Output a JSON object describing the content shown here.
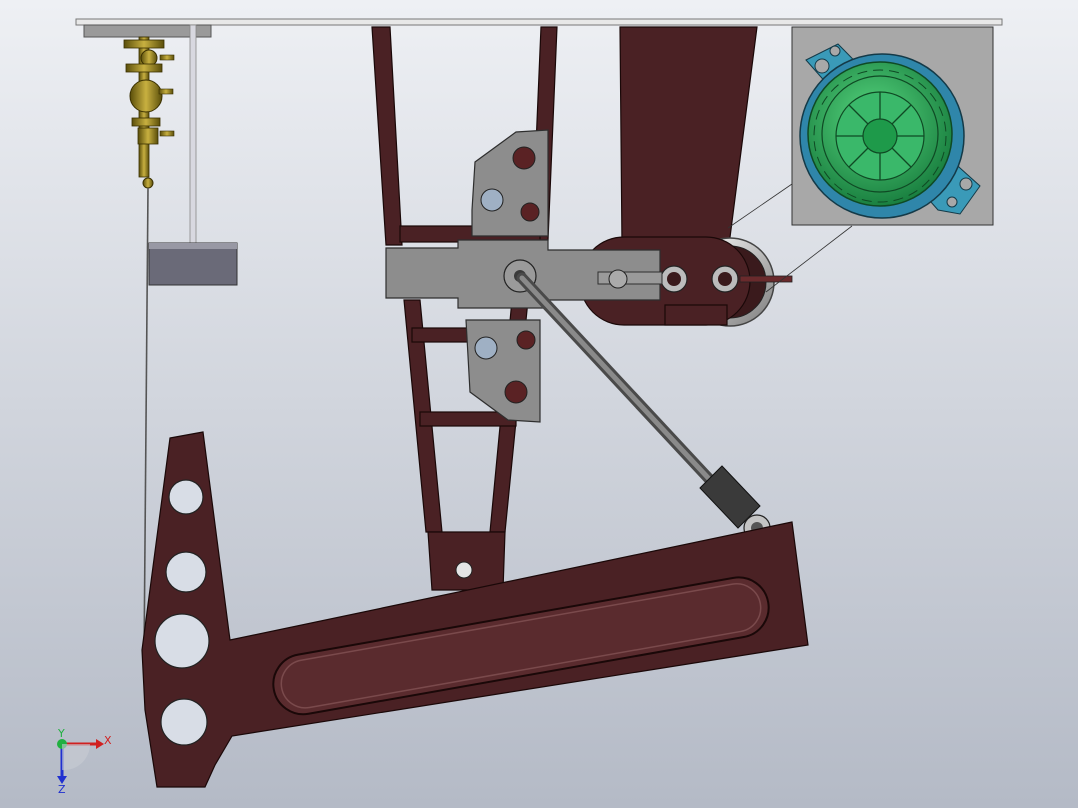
{
  "viewport": {
    "background_top": "#eef0f4",
    "background_bottom": "#b4bac6"
  },
  "colors": {
    "frame": "#4a2124",
    "frame_edge": "#2a0f10",
    "steel_gray": "#8c8c8c",
    "steel_dark": "#555555",
    "rod": "#6a6a6a",
    "brass": "#8a7a1a",
    "bearing_green": "#2fa85a",
    "bearing_ring": "#3a9ab8",
    "axis_x": "#d02020",
    "axis_y": "#20b040",
    "axis_z": "#2030d0"
  },
  "icons": {
    "triad": "coordinate-triad-icon"
  },
  "triad": {
    "x_label": "X",
    "y_label": "Y",
    "z_label": "Z"
  }
}
